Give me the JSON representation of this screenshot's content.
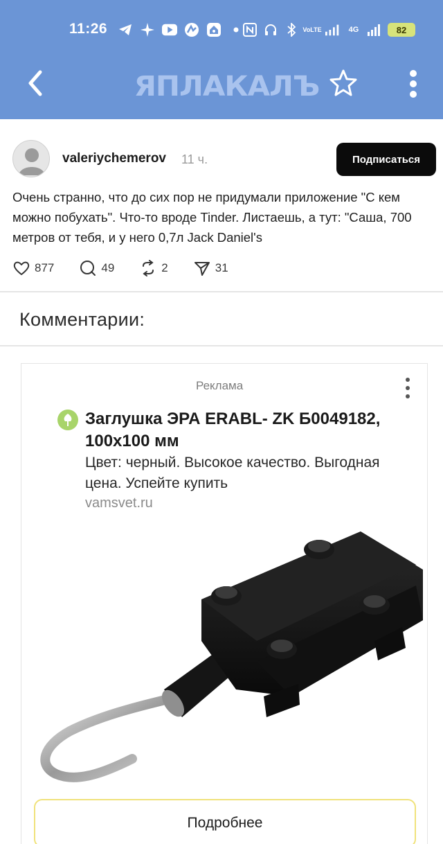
{
  "status_bar": {
    "time": "11:26",
    "network_vo_lte": "VoLTE",
    "network_4g": "4G",
    "battery": "82"
  },
  "nav": {
    "logo": "ЯПЛАКАЛЪ"
  },
  "post": {
    "author": "valeriychemerov",
    "time": "11 ч.",
    "subscribe_label": "Подписаться",
    "text": "Очень странно, что до сих пор не придумали приложение \"С кем можно побухать\". Что-то вроде Tinder. Листаешь, а тут: \"Саша, 700 метров от тебя, и у него 0,7л Jack Daniel's",
    "stats": {
      "likes": "877",
      "comments": "49",
      "reposts": "2",
      "shares": "31"
    }
  },
  "comments": {
    "title": "Комментарии:"
  },
  "ad": {
    "label": "Реклама",
    "title": "Заглушка ЭРА ERABL- ZK Б0049182, 100x100 мм",
    "description": "Цвет: черный. Высокое качество. Выгодная цена. Успейте купить",
    "domain": "vamsvet.ru",
    "button_label": "Подробнее"
  },
  "colors": {
    "header_bg": "#6b95d6",
    "logo": "#a9c3ee",
    "subscribe_bg": "#0b0b0b",
    "ad_button_border": "#f0e27a",
    "favicon": "#a8d46a"
  }
}
